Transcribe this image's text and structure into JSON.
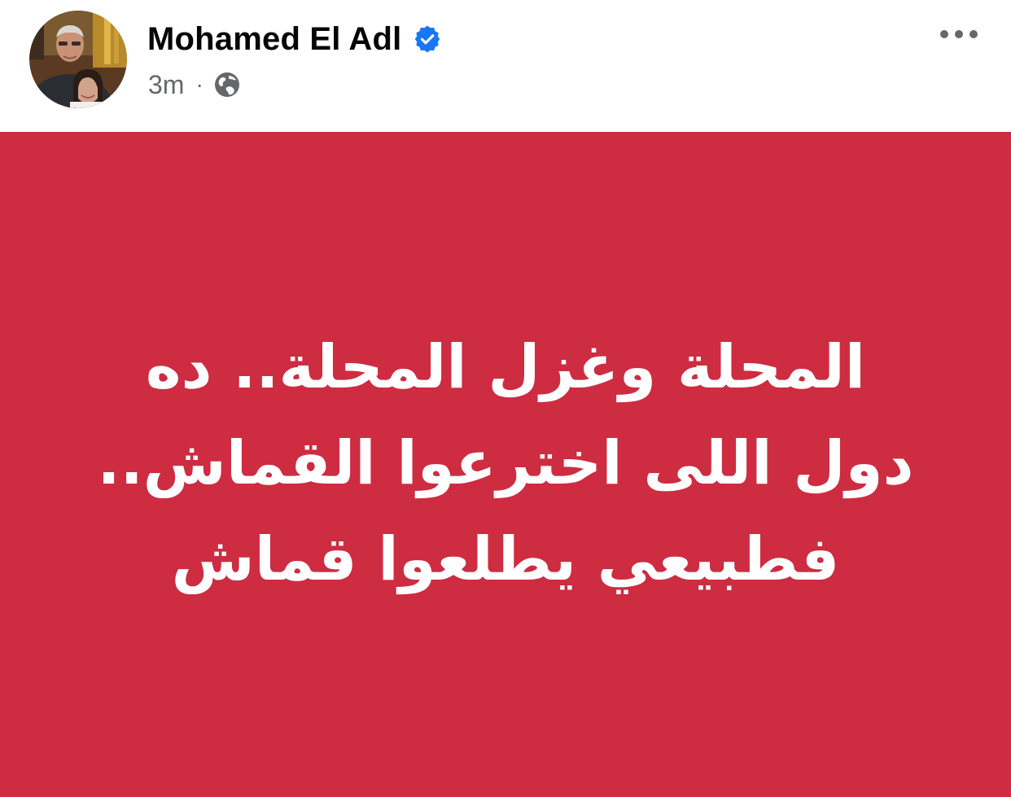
{
  "post": {
    "author": {
      "name": "Mohamed El Adl",
      "verified": true,
      "avatar_icon": "profile-photo"
    },
    "timestamp": "3m",
    "separator": "·",
    "audience_icon": "globe-icon",
    "more_icon": "more-horizontal-icon",
    "background_color": "#cd2c41",
    "text_color": "#ffffff",
    "verified_color": "#1877f2",
    "body_lines": [
      "المحلة وغزل المحلة.. ده",
      "دول اللى اخترعوا القماش..",
      "فطبيعي يطلعوا قماش"
    ]
  }
}
